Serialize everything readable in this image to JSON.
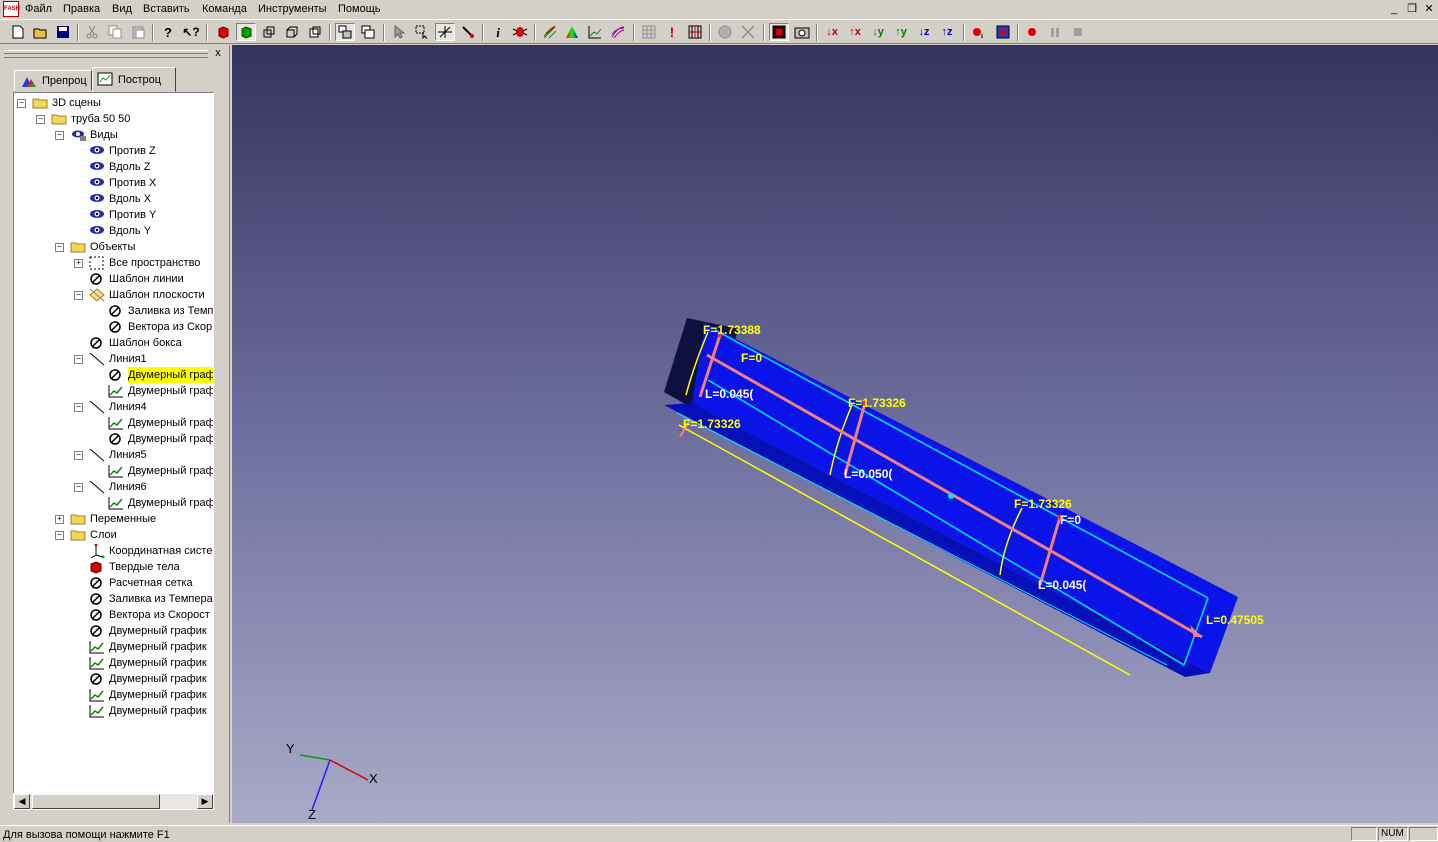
{
  "app": {
    "icon_label": "FASH"
  },
  "menu": [
    "Файл",
    "Правка",
    "Вид",
    "Вставить",
    "Команда",
    "Инструменты",
    "Помощь"
  ],
  "window_controls": {
    "minimize": "_",
    "restore": "❐",
    "close": "✕"
  },
  "toolbar_glyphs": {
    "info": "i",
    "down_x": "↓x",
    "up_x": "↑x",
    "down_y": "↓y",
    "up_y": "↑y",
    "down_z": "↓z",
    "up_z": "↑z",
    "exclaim": "!"
  },
  "panel": {
    "close_label": "x",
    "tabs": [
      {
        "label": "Препроц"
      },
      {
        "label": "Построц"
      }
    ],
    "tree": [
      {
        "label": "3D сцены",
        "indent": 0,
        "icon": "folder-icon",
        "pm": "−"
      },
      {
        "label": "труба 50 50",
        "indent": 1,
        "icon": "folder-icon",
        "pm": "−"
      },
      {
        "label": "Виды",
        "indent": 2,
        "icon": "views-icon",
        "pm": "−"
      },
      {
        "label": "Против Z",
        "indent": 3,
        "icon": "eye-icon"
      },
      {
        "label": "Вдоль Z",
        "indent": 3,
        "icon": "eye-icon"
      },
      {
        "label": "Против X",
        "indent": 3,
        "icon": "eye-icon"
      },
      {
        "label": "Вдоль X",
        "indent": 3,
        "icon": "eye-icon"
      },
      {
        "label": "Против Y",
        "indent": 3,
        "icon": "eye-icon"
      },
      {
        "label": "Вдоль Y",
        "indent": 3,
        "icon": "eye-icon"
      },
      {
        "label": "Объекты",
        "indent": 2,
        "icon": "folder-icon",
        "pm": "−"
      },
      {
        "label": "Все пространство",
        "indent": 3,
        "icon": "dashed-box-icon",
        "pm": "+"
      },
      {
        "label": "Шаблон линии",
        "indent": 3,
        "icon": "no-symbol-icon"
      },
      {
        "label": "Шаблон плоскости",
        "indent": 3,
        "icon": "plane-icon",
        "pm": "−"
      },
      {
        "label": "Заливка из Темп",
        "indent": 4,
        "icon": "no-symbol-icon"
      },
      {
        "label": "Вектора из Скор",
        "indent": 4,
        "icon": "no-symbol-icon"
      },
      {
        "label": "Шаблон бокса",
        "indent": 3,
        "icon": "no-symbol-icon"
      },
      {
        "label": "Линия1",
        "indent": 3,
        "icon": "line-icon",
        "pm": "−"
      },
      {
        "label": "Двумерный граф",
        "indent": 4,
        "icon": "no-symbol-icon",
        "selected": true
      },
      {
        "label": "Двумерный граф",
        "indent": 4,
        "icon": "graph-icon"
      },
      {
        "label": "Линия4",
        "indent": 3,
        "icon": "line-icon",
        "pm": "−"
      },
      {
        "label": "Двумерный граф",
        "indent": 4,
        "icon": "graph-icon"
      },
      {
        "label": "Двумерный граф",
        "indent": 4,
        "icon": "no-symbol-icon"
      },
      {
        "label": "Линия5",
        "indent": 3,
        "icon": "line-icon",
        "pm": "−"
      },
      {
        "label": "Двумерный граф",
        "indent": 4,
        "icon": "graph-icon"
      },
      {
        "label": "Линия6",
        "indent": 3,
        "icon": "line-icon",
        "pm": "−"
      },
      {
        "label": "Двумерный граф",
        "indent": 4,
        "icon": "graph-icon"
      },
      {
        "label": "Переменные",
        "indent": 2,
        "icon": "folder-icon",
        "pm": "+"
      },
      {
        "label": "Слои",
        "indent": 2,
        "icon": "folder-icon",
        "pm": "−"
      },
      {
        "label": "Координатная систе",
        "indent": 3,
        "icon": "axes-icon"
      },
      {
        "label": "Твердые тела",
        "indent": 3,
        "icon": "solid-icon"
      },
      {
        "label": "Расчетная сетка",
        "indent": 3,
        "icon": "no-symbol-icon"
      },
      {
        "label": "Заливка из Темпера",
        "indent": 3,
        "icon": "no-symbol-icon"
      },
      {
        "label": "Вектора из Скорост",
        "indent": 3,
        "icon": "no-symbol-icon"
      },
      {
        "label": "Двумерный график",
        "indent": 3,
        "icon": "no-symbol-icon"
      },
      {
        "label": "Двумерный график",
        "indent": 3,
        "icon": "graph-icon"
      },
      {
        "label": "Двумерный график",
        "indent": 3,
        "icon": "graph-icon"
      },
      {
        "label": "Двумерный график",
        "indent": 3,
        "icon": "no-symbol-icon"
      },
      {
        "label": "Двумерный график",
        "indent": 3,
        "icon": "graph-icon"
      },
      {
        "label": "Двумерный график",
        "indent": 3,
        "icon": "graph-icon"
      }
    ]
  },
  "scene": {
    "labels": {
      "f_top_overlap": "F=1.73388",
      "f_zero_left": "F=0",
      "l_left": "L=0.045(",
      "f_left_low": "F=1.73326",
      "f_mid": "F=1.73326",
      "l_mid": "L=0.050(",
      "f_right": "F=1.73326",
      "f_zero_right": "F=0",
      "l_right": "L=0.045(",
      "l_end": "L=0.47505"
    },
    "axes": {
      "x": "X",
      "y": "Y",
      "z": "Z"
    },
    "colors": {
      "box": "#0a14e8",
      "edge": "#00e5ff",
      "vector": "#f08080",
      "label": "#ffff00"
    }
  },
  "status": {
    "text": "Для вызова помощи нажмите F1",
    "num": "NUM"
  }
}
